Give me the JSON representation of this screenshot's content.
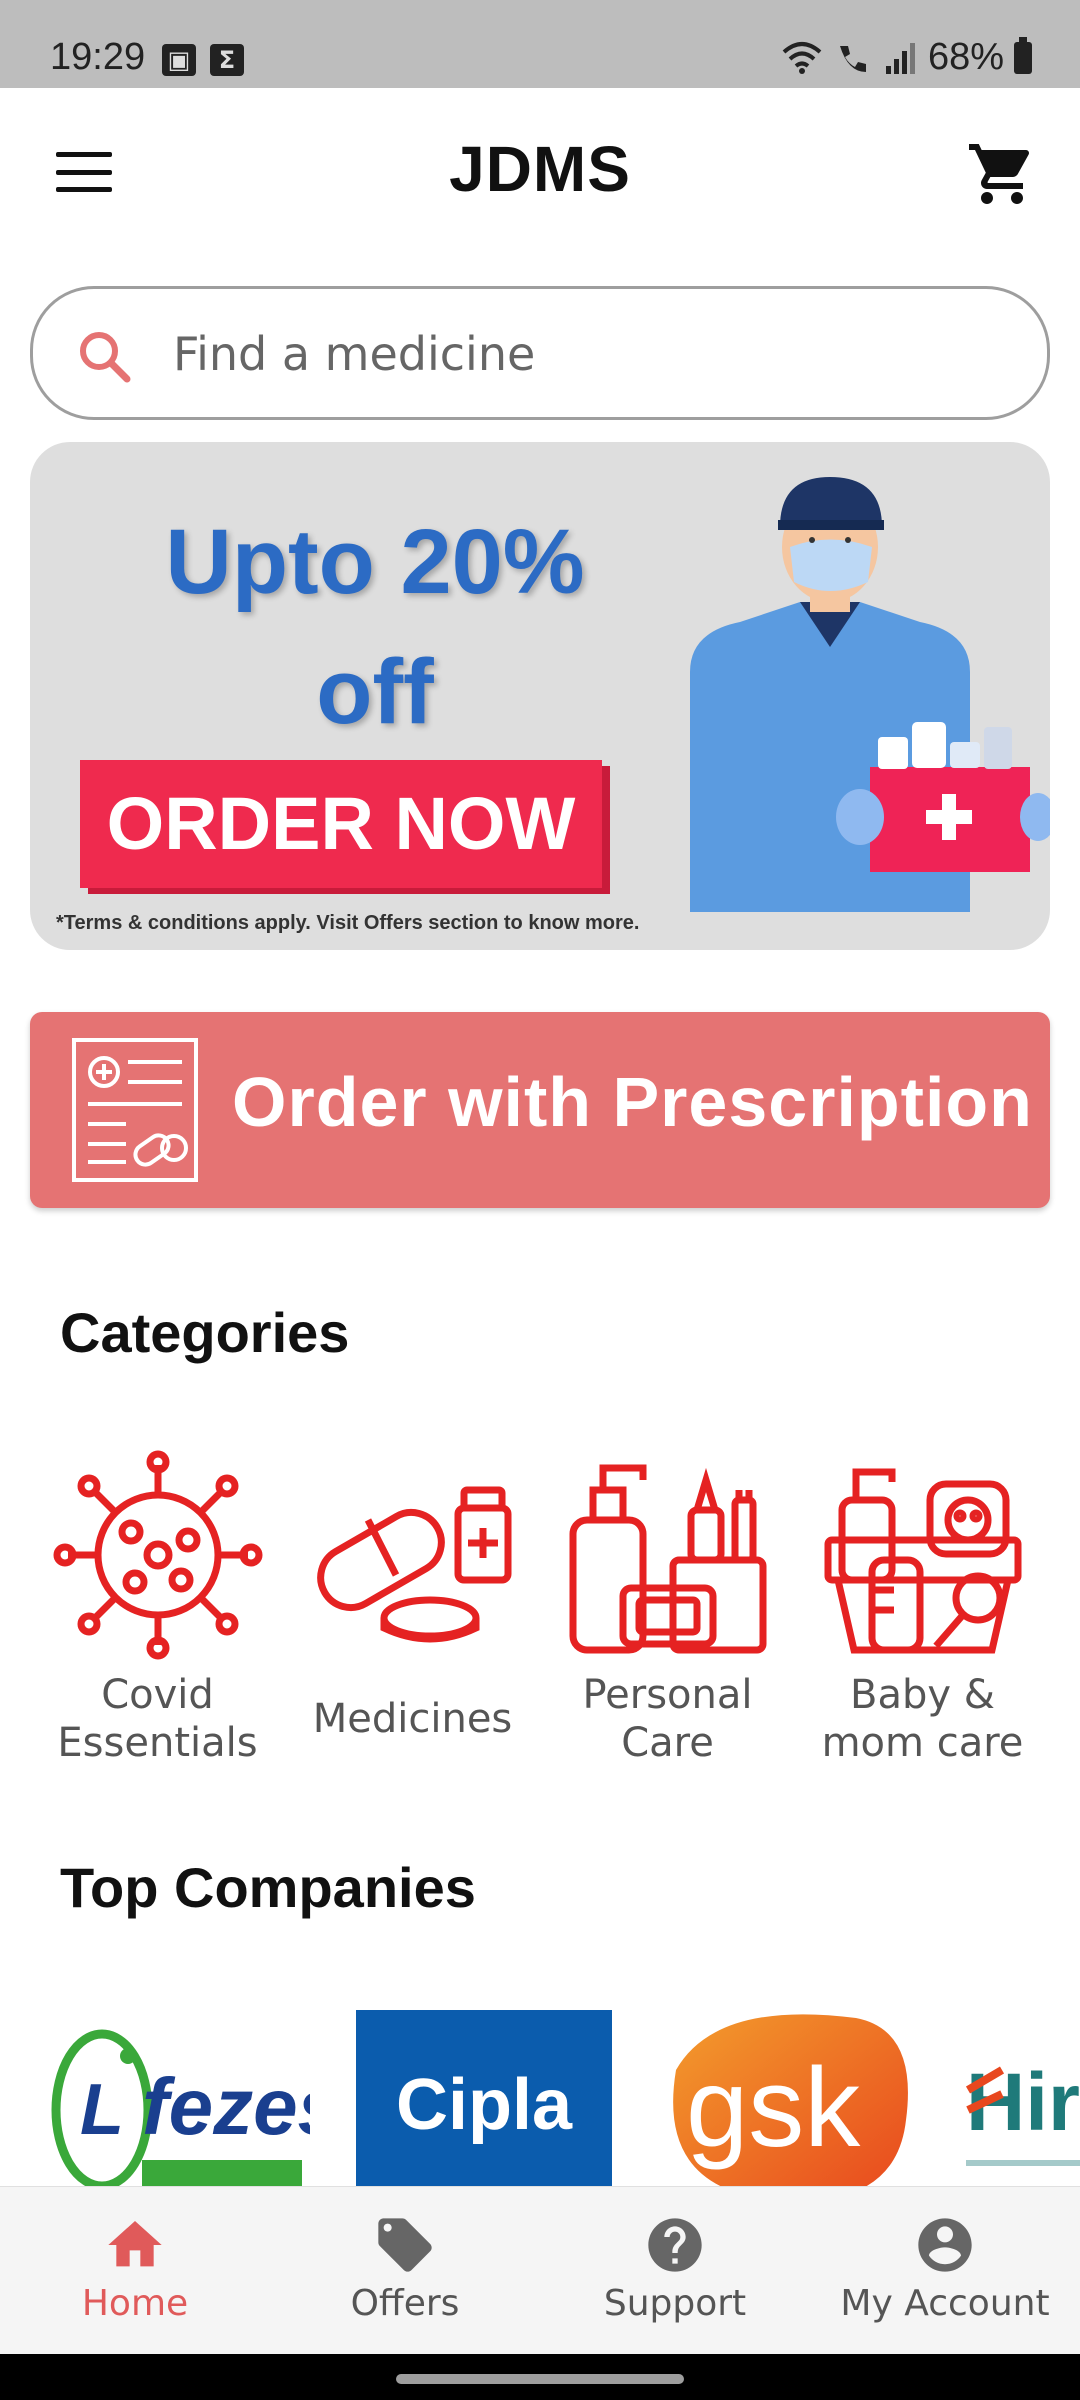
{
  "status_bar": {
    "time": "19:29",
    "battery": "68%"
  },
  "app_bar": {
    "title": "JDMS"
  },
  "search": {
    "placeholder": "Find a medicine"
  },
  "banner": {
    "headline_line1": "Upto 20%",
    "headline_line2": "off",
    "cta": "ORDER NOW",
    "terms": "*Terms & conditions apply. Visit Offers section to know more."
  },
  "prescription": {
    "label": "Order with Prescription"
  },
  "categories": {
    "title": "Categories",
    "items": [
      {
        "label": "Covid Essentials",
        "icon": "virus-icon"
      },
      {
        "label": "Medicines",
        "icon": "pills-icon"
      },
      {
        "label": "Personal Care",
        "icon": "personal-care-icon"
      },
      {
        "label": "Baby & mom care",
        "icon": "baby-care-icon"
      }
    ]
  },
  "companies": {
    "title": "Top Companies",
    "items": [
      {
        "name": "Lifezest",
        "logo_text": "fezest"
      },
      {
        "name": "Cipla",
        "logo_text": "Cipla"
      },
      {
        "name": "gsk",
        "logo_text": "gsk"
      },
      {
        "name": "Hir",
        "logo_text": "Hir"
      }
    ]
  },
  "bottom_nav": {
    "items": [
      {
        "label": "Home",
        "icon": "home-icon",
        "active": true
      },
      {
        "label": "Offers",
        "icon": "tag-icon",
        "active": false
      },
      {
        "label": "Support",
        "icon": "help-icon",
        "active": false
      },
      {
        "label": "My Account",
        "icon": "account-icon",
        "active": false
      }
    ]
  },
  "colors": {
    "accent": "#e57373",
    "icon_red": "#e52222",
    "banner_blue": "#2c6bc4",
    "cta_red": "#ef2a4e",
    "nav_active": "#e05a5a"
  }
}
